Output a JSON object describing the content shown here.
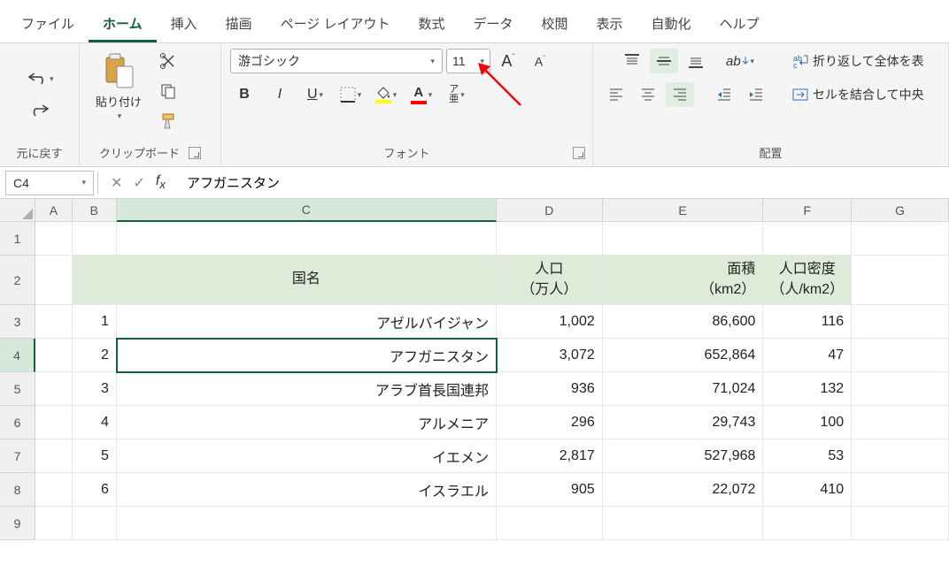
{
  "tabs": {
    "file": "ファイル",
    "home": "ホーム",
    "insert": "挿入",
    "draw": "描画",
    "page_layout": "ページ レイアウト",
    "formulas": "数式",
    "data": "データ",
    "review": "校閲",
    "view": "表示",
    "automate": "自動化",
    "help": "ヘルプ"
  },
  "ribbon": {
    "undo_group": "元に戻す",
    "clipboard": {
      "label": "クリップボード",
      "paste": "貼り付け"
    },
    "font": {
      "label": "フォント",
      "name": "游ゴシック",
      "size": "11",
      "bold": "B",
      "italic": "I",
      "underline": "U",
      "orientation": "ア\n亜"
    },
    "alignment": {
      "label": "配置",
      "wrap": "折り返して全体を表",
      "merge": "セルを結合して中央"
    }
  },
  "formula_bar": {
    "cell_ref": "C4",
    "value": "アフガニスタン"
  },
  "columns": [
    "A",
    "B",
    "C",
    "D",
    "E",
    "F",
    "G"
  ],
  "header_row": {
    "C": "国名",
    "D": "人口\n（万人）",
    "E": "面積\n（km2）",
    "F": "人口密度\n（人/km2）"
  },
  "rows": [
    {
      "n": "1",
      "B": "1",
      "C": "アゼルバイジャン",
      "D": "1,002",
      "E": "86,600",
      "F": "116"
    },
    {
      "n": "2",
      "B": "2",
      "C": "アフガニスタン",
      "D": "3,072",
      "E": "652,864",
      "F": "47"
    },
    {
      "n": "3",
      "B": "3",
      "C": "アラブ首長国連邦",
      "D": "936",
      "E": "71,024",
      "F": "132"
    },
    {
      "n": "4",
      "B": "4",
      "C": "アルメニア",
      "D": "296",
      "E": "29,743",
      "F": "100"
    },
    {
      "n": "5",
      "B": "5",
      "C": "イエメン",
      "D": "2,817",
      "E": "527,968",
      "F": "53"
    },
    {
      "n": "6",
      "B": "6",
      "C": "イスラエル",
      "D": "905",
      "E": "22,072",
      "F": "410"
    }
  ],
  "selected_row_index": 1,
  "selected_col": "C"
}
